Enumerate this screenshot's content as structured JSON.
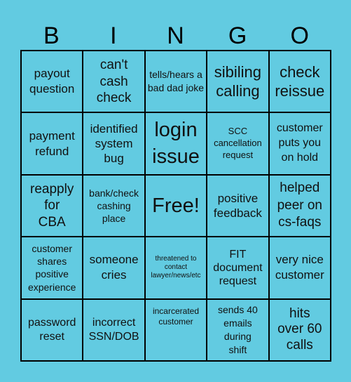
{
  "card": {
    "background_color": "#62cbe1",
    "header_letters": [
      "B",
      "I",
      "N",
      "G",
      "O"
    ],
    "rows": [
      [
        "payout question",
        "can't cash check",
        "tells/hears a bad dad joke",
        "sibiling calling",
        "check reissue"
      ],
      [
        "payment refund",
        "identified system bug",
        "login issue",
        "SCC cancellation request",
        "customer puts you on hold"
      ],
      [
        "reapply for CBA",
        "bank/check cashing place",
        "Free!",
        "positive feedback",
        "helped peer on cs-faqs"
      ],
      [
        "customer shares positive experience",
        "someone cries",
        "threatened to contact lawyer/news/etc",
        "FIT document request",
        "very nice customer"
      ],
      [
        "password reset",
        "incorrect SSN/DOB",
        "incarcerated customer",
        "sends 40 emails during shift",
        "hits over 60 calls"
      ]
    ]
  }
}
